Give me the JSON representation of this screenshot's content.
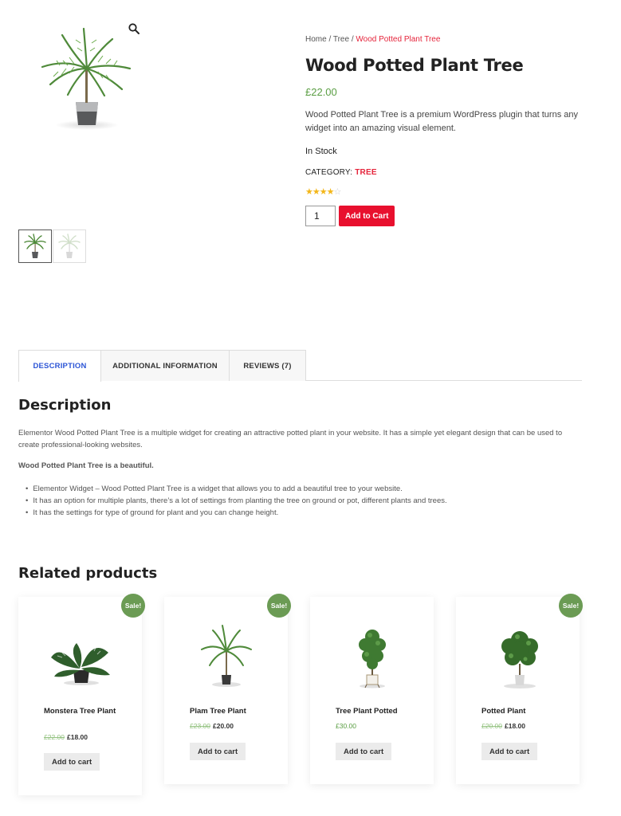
{
  "product": {
    "breadcrumb": {
      "home": "Home",
      "category": "Tree",
      "current": "Wood Potted Plant Tree",
      "sep": "/"
    },
    "title": "Wood Potted Plant Tree",
    "price": "£22.00",
    "short_description": "Wood Potted Plant Tree is a premium WordPress plugin that turns any widget into an amazing visual element.",
    "stock": "In Stock",
    "category_label": "CATEGORY:",
    "category_value": "TREE",
    "rating": {
      "stars_filled": "★★★★",
      "stars_empty": "☆",
      "value": 4
    },
    "quantity": "1",
    "add_to_cart": "Add to Cart"
  },
  "tabs": [
    {
      "label": "DESCRIPTION",
      "active": true
    },
    {
      "label": "ADDITIONAL INFORMATION",
      "active": false
    },
    {
      "label": "REVIEWS (7)",
      "active": false
    }
  ],
  "description": {
    "heading": "Description",
    "paragraph": "Elementor Wood Potted Plant Tree is a multiple widget for creating an attractive potted plant in your website. It has a simple yet elegant design that can be used to create professional-looking websites.",
    "bold_line": "Wood Potted Plant Tree is a beautiful.",
    "bullets": [
      "Elementor Widget – Wood Potted Plant Tree is a widget that allows you to add a beautiful tree to your website.",
      "It has an option for multiple plants, there’s a lot of settings from planting the tree on ground or pot, different plants and trees.",
      "It has the settings for type of ground for plant and you can change height."
    ]
  },
  "related": {
    "heading": "Related products",
    "items": [
      {
        "name": "Monstera Tree Plant",
        "old_price": "£22.00",
        "price": "£18.00",
        "sale": "Sale!",
        "button": "Add to cart"
      },
      {
        "name": "Plam Tree Plant",
        "old_price": "£23.00",
        "price": "£20.00",
        "sale": "Sale!",
        "button": "Add to cart"
      },
      {
        "name": "Tree Plant Potted",
        "old_price": "",
        "price": "£30.00",
        "sale": "",
        "button": "Add to cart"
      },
      {
        "name": "Potted Plant",
        "old_price": "£20.00",
        "price": "£18.00",
        "sale": "Sale!",
        "button": "Add to cart"
      }
    ]
  },
  "colors": {
    "accent_red": "#e5243b",
    "button_red": "#e8102e",
    "price_green": "#5a9e43",
    "sale_green": "#6b9b54",
    "tab_blue": "#2c55d6",
    "star_gold": "#f3b619"
  },
  "icons": {
    "zoom": "magnifier-icon"
  }
}
